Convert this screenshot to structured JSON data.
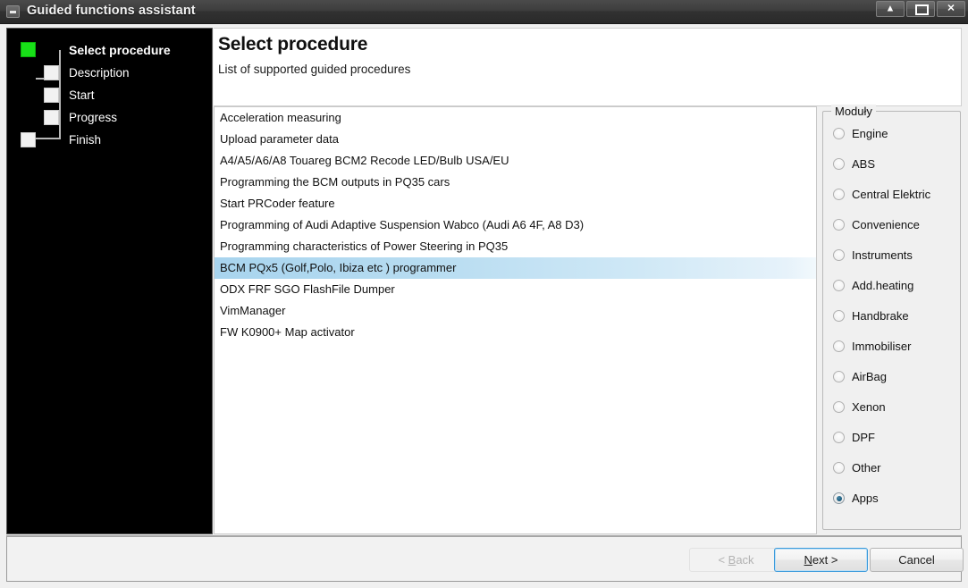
{
  "window": {
    "title": "Guided functions assistant",
    "sysmenu_icon": "window-menu-icon",
    "controls": [
      {
        "name": "minimize-button",
        "glyph": "▲"
      },
      {
        "name": "maximize-button",
        "glyph": ""
      },
      {
        "name": "close-button",
        "glyph": "✕"
      }
    ]
  },
  "sidebar": {
    "steps": [
      {
        "label": "Select procedure",
        "state": "active"
      },
      {
        "label": "Description",
        "state": "pending"
      },
      {
        "label": "Start",
        "state": "pending"
      },
      {
        "label": "Progress",
        "state": "pending"
      },
      {
        "label": "Finish",
        "state": "pending"
      }
    ]
  },
  "header": {
    "title": "Select procedure",
    "subtitle": "List of supported guided procedures"
  },
  "procedures": {
    "items": [
      {
        "label": "Acceleration measuring",
        "selected": false
      },
      {
        "label": "Upload parameter data",
        "selected": false
      },
      {
        "label": "A4/A5/A6/A8 Touareg BCM2 Recode LED/Bulb USA/EU",
        "selected": false
      },
      {
        "label": "Programming the BCM outputs in PQ35 cars",
        "selected": false
      },
      {
        "label": "Start PRCoder feature",
        "selected": false
      },
      {
        "label": "Programming of Audi Adaptive Suspension Wabco (Audi A6 4F, A8 D3)",
        "selected": false
      },
      {
        "label": "Programming characteristics of Power Steering in PQ35",
        "selected": false
      },
      {
        "label": "BCM PQx5 (Golf,Polo, Ibiza etc ) programmer",
        "selected": true
      },
      {
        "label": "ODX FRF SGO FlashFile Dumper",
        "selected": false
      },
      {
        "label": "VimManager",
        "selected": false
      },
      {
        "label": "FW K0900+ Map activator",
        "selected": false
      }
    ]
  },
  "modules": {
    "group_title": "Moduły",
    "options": [
      {
        "label": "Engine",
        "checked": false
      },
      {
        "label": "ABS",
        "checked": false
      },
      {
        "label": "Central Elektric",
        "checked": false
      },
      {
        "label": "Convenience",
        "checked": false
      },
      {
        "label": "Instruments",
        "checked": false
      },
      {
        "label": "Add.heating",
        "checked": false
      },
      {
        "label": "Handbrake",
        "checked": false
      },
      {
        "label": "Immobiliser",
        "checked": false
      },
      {
        "label": "AirBag",
        "checked": false
      },
      {
        "label": "Xenon",
        "checked": false
      },
      {
        "label": "DPF",
        "checked": false
      },
      {
        "label": "Other",
        "checked": false
      },
      {
        "label": "Apps",
        "checked": true
      }
    ]
  },
  "footer": {
    "back_label": "< Back",
    "back_disabled": true,
    "next_label_prefix": "",
    "next_label": "Next >",
    "next_focused": true,
    "cancel_label": "Cancel"
  },
  "colors": {
    "accent_green": "#18e018",
    "selection_blue": "#a8d4ee",
    "focus_blue": "#3c9bdc",
    "radio_dot": "#1d5e80"
  }
}
